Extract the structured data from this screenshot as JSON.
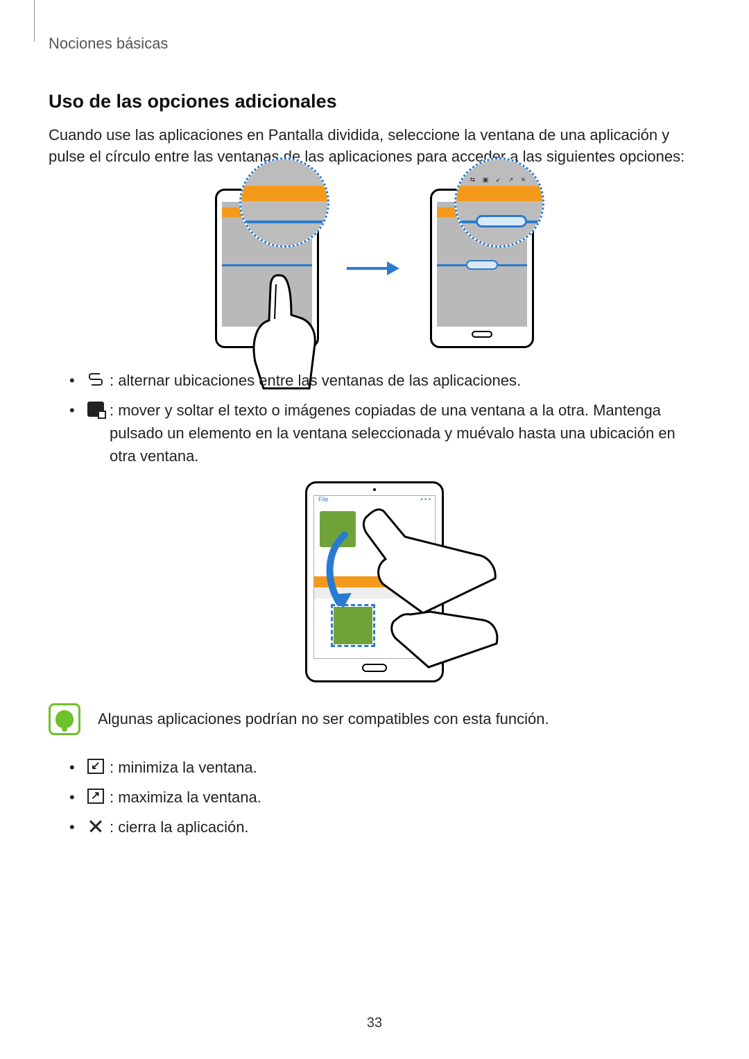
{
  "breadcrumb": "Nociones básicas",
  "section_title": "Uso de las opciones adicionales",
  "intro": "Cuando use las aplicaciones en Pantalla dividida, seleccione la ventana de una aplicación y pulse el círculo entre las ventanas de las aplicaciones para acceder a las siguientes opciones:",
  "bullets1": {
    "swap": " : alternar ubicaciones entre las ventanas de las aplicaciones.",
    "drag": " : mover y soltar el texto o imágenes copiadas de una ventana a la otra. Mantenga pulsado un elemento en la ventana seleccionada y muévalo hasta una ubicación en otra ventana."
  },
  "note": "Algunas aplicaciones podrían no ser compatibles con esta función.",
  "bullets2": {
    "minimize": " : minimiza la ventana.",
    "maximize": " : maximiza la ventana.",
    "close": " : cierra la aplicación."
  },
  "page_number": "33"
}
